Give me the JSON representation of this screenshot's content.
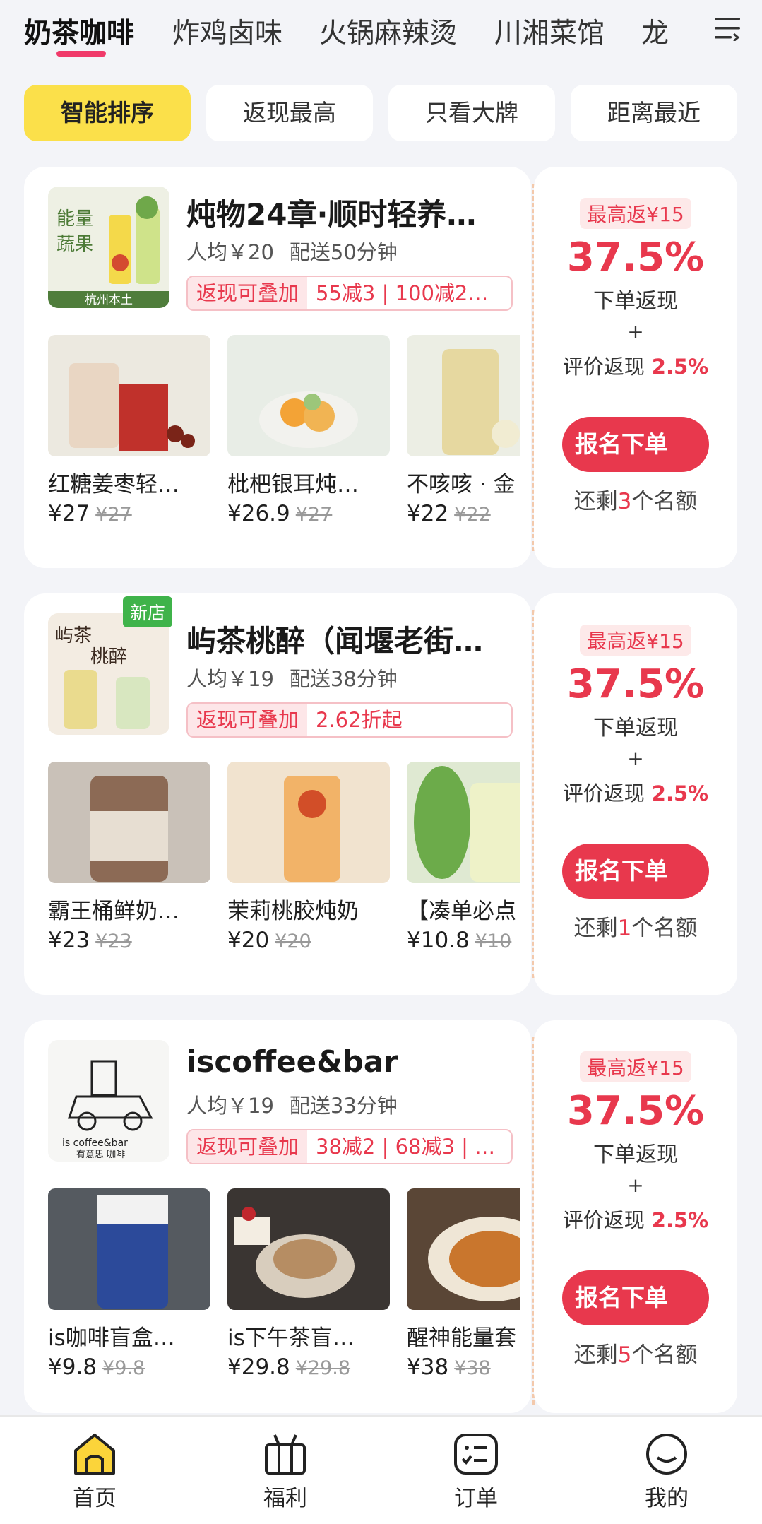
{
  "categories": [
    "奶茶咖啡",
    "炸鸡卤味",
    "火锅麻辣烫",
    "川湘菜馆",
    "龙"
  ],
  "sort_options": [
    "智能排序",
    "返现最高",
    "只看大牌",
    "距离最近"
  ],
  "stores": [
    {
      "name": "炖物24章·顺时轻养…",
      "price_avg": "人均￥20",
      "delivery": "配送50分钟",
      "promo_tag": "返现可叠加",
      "promo_text": "55减3 | 100减2…",
      "new_badge": "",
      "logo_text": [
        "能量",
        "蔬果",
        "杭州本土"
      ],
      "products": [
        {
          "name": "红糖姜枣轻…",
          "price": "¥27",
          "orig": "¥27"
        },
        {
          "name": "枇杷银耳炖…",
          "price": "¥26.9",
          "orig": "¥27"
        },
        {
          "name": "不咳咳 · 金",
          "price": "¥22",
          "orig": "¥22"
        }
      ],
      "max_cashback": "最高返¥15",
      "rate": "37.5%",
      "rate_label": "下单返现",
      "plus": "+",
      "review_label": "评价返现",
      "review_rate": "2.5%",
      "button": "报名下单",
      "remain_prefix": "还剩",
      "remain_count": "3",
      "remain_suffix": "个名额"
    },
    {
      "name": "屿茶桃醉（闻堰老街…",
      "price_avg": "人均￥19",
      "delivery": "配送38分钟",
      "promo_tag": "返现可叠加",
      "promo_text": "2.62折起",
      "new_badge": "新店",
      "logo_text": [
        "屿茶",
        "桃醉"
      ],
      "products": [
        {
          "name": "霸王桶鲜奶…",
          "price": "¥23",
          "orig": "¥23"
        },
        {
          "name": "茉莉桃胶炖奶",
          "price": "¥20",
          "orig": "¥20"
        },
        {
          "name": "【凑单必点",
          "price": "¥10.8",
          "orig": "¥10"
        }
      ],
      "max_cashback": "最高返¥15",
      "rate": "37.5%",
      "rate_label": "下单返现",
      "plus": "+",
      "review_label": "评价返现",
      "review_rate": "2.5%",
      "button": "报名下单",
      "remain_prefix": "还剩",
      "remain_count": "1",
      "remain_suffix": "个名额"
    },
    {
      "name": "iscoffee&bar",
      "price_avg": "人均￥19",
      "delivery": "配送33分钟",
      "promo_tag": "返现可叠加",
      "promo_text": "38减2 | 68减3 | …",
      "new_badge": "",
      "logo_text": [
        "is coffee&bar",
        "有意思 咖啡"
      ],
      "products": [
        {
          "name": "is咖啡盲盒…",
          "price": "¥9.8",
          "orig": "¥9.8"
        },
        {
          "name": "is下午茶盲…",
          "price": "¥29.8",
          "orig": "¥29.8"
        },
        {
          "name": "醒神能量套",
          "price": "¥38",
          "orig": "¥38"
        }
      ],
      "max_cashback": "最高返¥15",
      "rate": "37.5%",
      "rate_label": "下单返现",
      "plus": "+",
      "review_label": "评价返现",
      "review_rate": "2.5%",
      "button": "报名下单",
      "remain_prefix": "还剩",
      "remain_count": "5",
      "remain_suffix": "个名额"
    }
  ],
  "bottom_nav": [
    "首页",
    "福利",
    "订单",
    "我的"
  ],
  "colors": {
    "accent_red": "#e8384d",
    "tab_yellow": "#fbe04a",
    "underline_pink": "#f03a6a"
  }
}
